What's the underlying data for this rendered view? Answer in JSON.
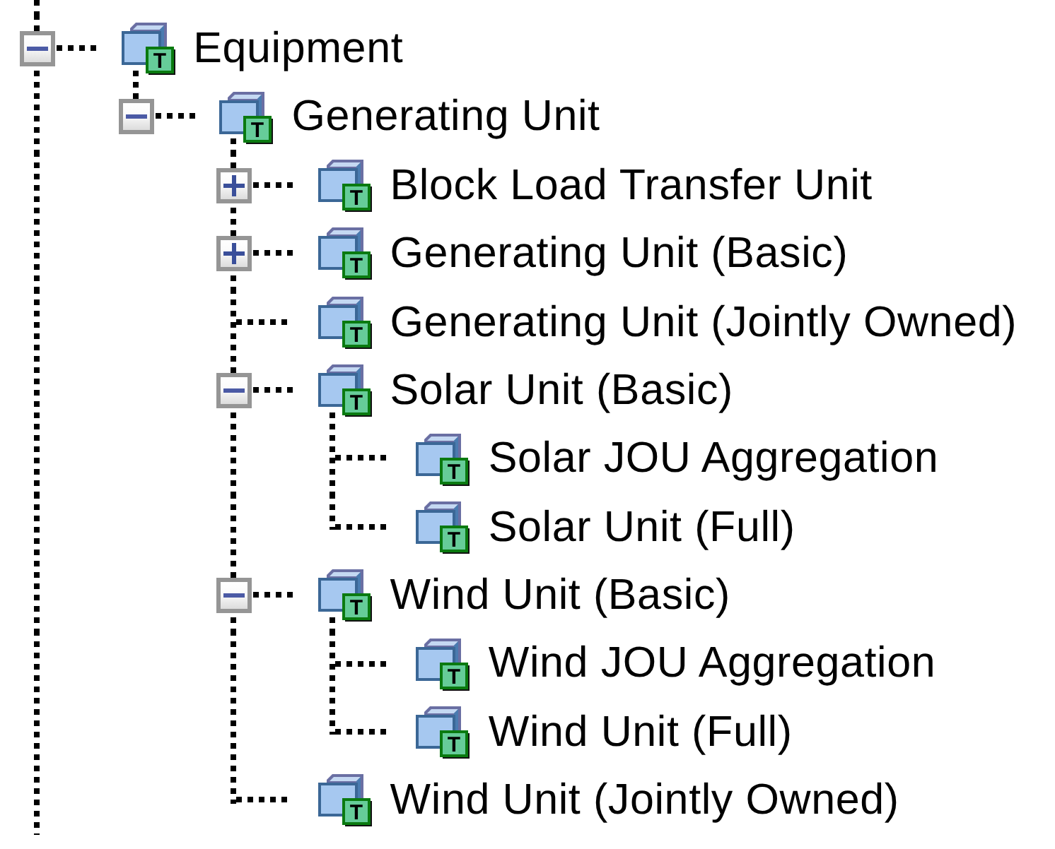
{
  "tree": [
    {
      "label": "Equipment",
      "badge": "T",
      "expanded": true,
      "children": [
        {
          "label": "Generating Unit",
          "badge": "T",
          "expanded": true,
          "children": [
            {
              "label": "Block Load Transfer Unit",
              "badge": "T",
              "expanded": false
            },
            {
              "label": "Generating Unit (Basic)",
              "badge": "T",
              "expanded": false
            },
            {
              "label": "Generating Unit (Jointly Owned)",
              "badge": "T"
            },
            {
              "label": "Solar Unit (Basic)",
              "badge": "T",
              "expanded": true,
              "children": [
                {
                  "label": "Solar JOU Aggregation",
                  "badge": "T"
                },
                {
                  "label": "Solar Unit (Full)",
                  "badge": "T"
                }
              ]
            },
            {
              "label": "Wind Unit (Basic)",
              "badge": "T",
              "expanded": true,
              "children": [
                {
                  "label": "Wind JOU Aggregation",
                  "badge": "T"
                },
                {
                  "label": "Wind Unit (Full)",
                  "badge": "T"
                }
              ]
            },
            {
              "label": "Wind Unit (Jointly Owned)",
              "badge": "T"
            }
          ]
        }
      ]
    }
  ]
}
